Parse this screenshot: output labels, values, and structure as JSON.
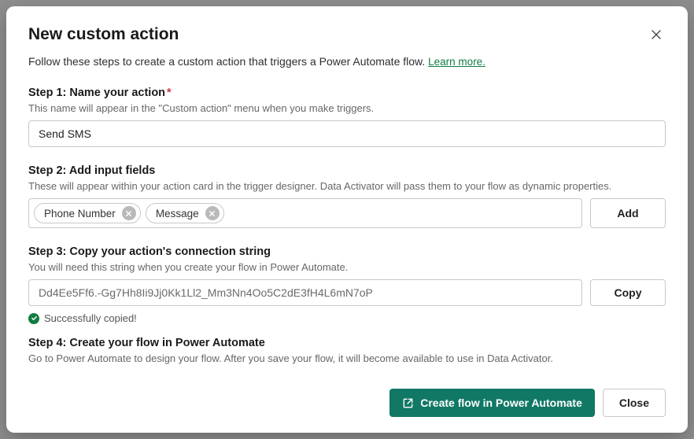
{
  "title": "New custom action",
  "intro": "Follow these steps to create a custom action that triggers a Power Automate flow.",
  "learn_more": "Learn more.",
  "step1": {
    "heading": "Step 1: Name your action",
    "sub": "This name will appear in the \"Custom action\" menu when you make triggers.",
    "value": "Send SMS"
  },
  "step2": {
    "heading": "Step 2: Add input fields",
    "sub": "These will appear within your action card in the trigger designer. Data Activator will pass them to your flow as dynamic properties.",
    "chips": [
      "Phone Number",
      "Message"
    ],
    "add_label": "Add"
  },
  "step3": {
    "heading": "Step 3: Copy your action's connection string",
    "sub": "You will need this string when you create your flow in Power Automate.",
    "value": "Dd4Ee5Ff6.-Gg7Hh8Ii9Jj0Kk1Ll2_Mm3Nn4Oo5C2dE3fH4L6mN7oP",
    "copy_label": "Copy",
    "status": "Successfully copied!"
  },
  "step4": {
    "heading": "Step 4: Create your flow in Power Automate",
    "sub": "Go to Power Automate to design your flow. After you save your flow, it will become available to use in Data Activator."
  },
  "footer": {
    "primary": "Create flow in Power Automate",
    "close": "Close"
  }
}
